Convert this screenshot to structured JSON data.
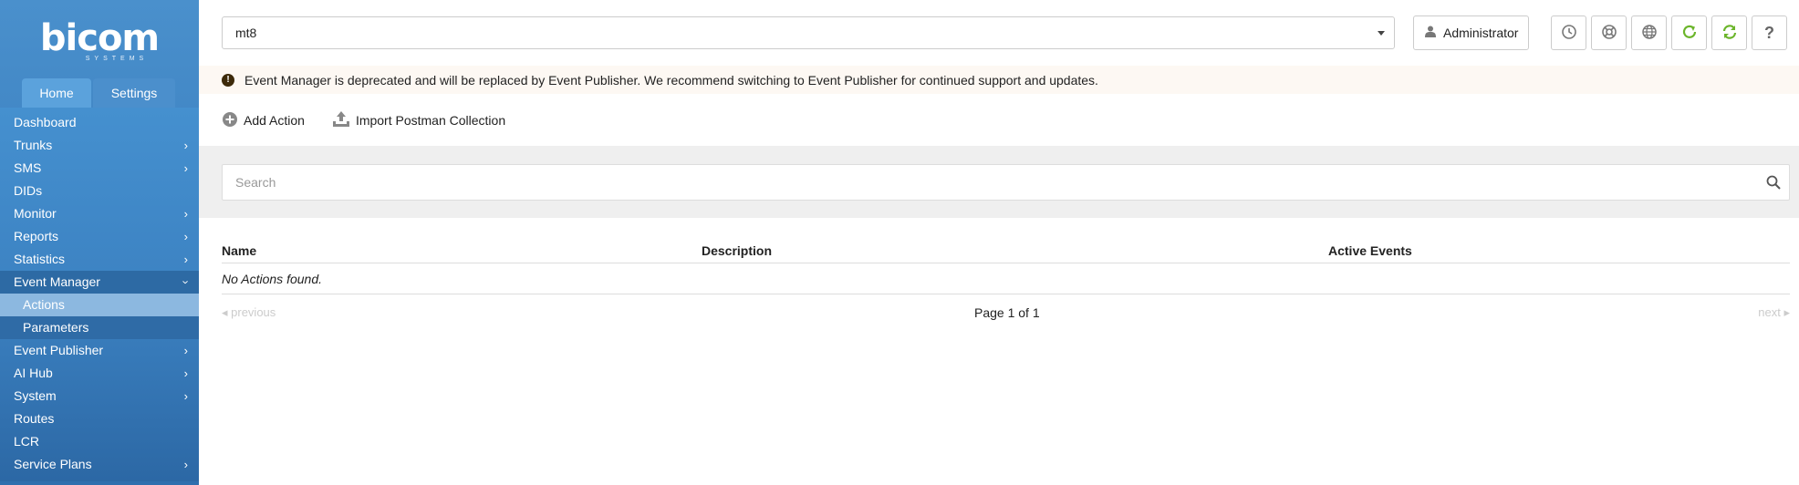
{
  "brand": {
    "name": "bicom",
    "sub": "SYSTEMS"
  },
  "sidebar": {
    "tabs": [
      {
        "label": "Home",
        "active": true
      },
      {
        "label": "Settings",
        "active": false
      }
    ],
    "items": [
      {
        "label": "Dashboard",
        "chevron": false
      },
      {
        "label": "Trunks",
        "chevron": true
      },
      {
        "label": "SMS",
        "chevron": true
      },
      {
        "label": "DIDs",
        "chevron": false
      },
      {
        "label": "Monitor",
        "chevron": true
      },
      {
        "label": "Reports",
        "chevron": true
      },
      {
        "label": "Statistics",
        "chevron": true
      },
      {
        "label": "Event Manager",
        "chevron": true,
        "open": true
      },
      {
        "label": "Actions",
        "sub": true,
        "selected": true
      },
      {
        "label": "Parameters",
        "sub": true
      },
      {
        "label": "Event Publisher",
        "chevron": true
      },
      {
        "label": "AI Hub",
        "chevron": true
      },
      {
        "label": "System",
        "chevron": true
      },
      {
        "label": "Routes",
        "chevron": false
      },
      {
        "label": "LCR",
        "chevron": false
      },
      {
        "label": "Service Plans",
        "chevron": true
      }
    ]
  },
  "topbar": {
    "tenant_select": "mt8",
    "user_label": "Administrator",
    "icons": [
      "clock-icon",
      "lifebuoy-icon",
      "globe-icon",
      "reload-icon",
      "sync-icon",
      "help-icon"
    ]
  },
  "alert": {
    "text": "Event Manager is deprecated and will be replaced by Event Publisher. We recommend switching to Event Publisher for continued support and updates."
  },
  "actions": {
    "add_label": "Add Action",
    "import_label": "Import Postman Collection"
  },
  "search": {
    "placeholder": "Search"
  },
  "table": {
    "columns": [
      "Name",
      "Description",
      "Active Events"
    ],
    "empty_text": "No Actions found."
  },
  "pager": {
    "prev": "previous",
    "page": "Page 1 of 1",
    "next": "next"
  },
  "colors": {
    "accent": "#3a85c8",
    "green": "#6bb52a",
    "alert_bg": "#fdf8f3"
  }
}
